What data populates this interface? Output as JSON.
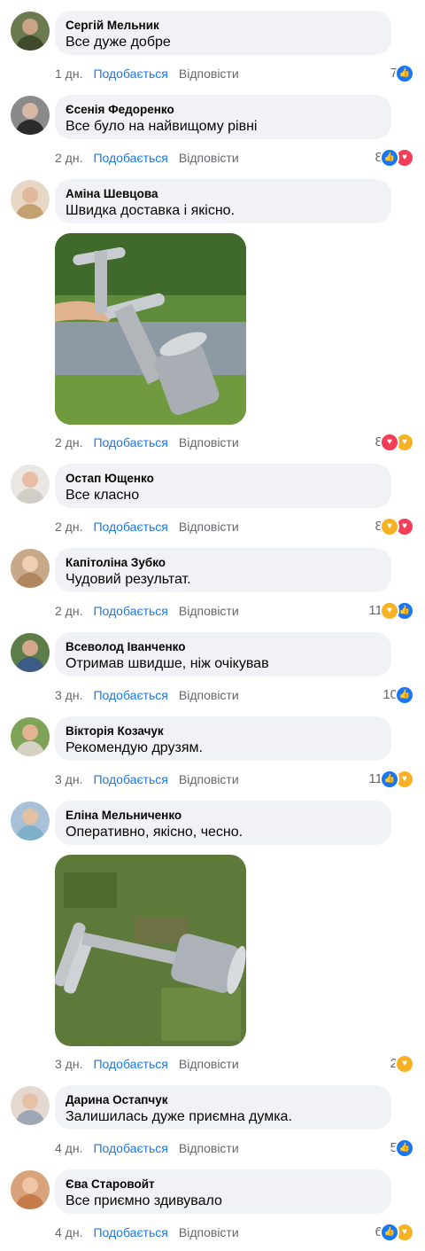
{
  "labels": {
    "like": "Подобається",
    "reply": "Відповісти"
  },
  "comments": [
    {
      "name": "Сергій Мельник",
      "text": "Все дуже добре",
      "time": "1 дн.",
      "count": "7",
      "reactions": [
        "like"
      ]
    },
    {
      "name": "Єсенія Федоренко",
      "text": "Все було на найвищому рівні",
      "time": "2 дн.",
      "count": "8",
      "reactions": [
        "like",
        "love"
      ]
    },
    {
      "name": "Аміна Шевцова",
      "text": "Швидка доставка і якісно.",
      "time": "2 дн.",
      "count": "8",
      "reactions": [
        "love",
        "care"
      ]
    },
    {
      "name": "Остап Ющенко",
      "text": "Все класно",
      "time": "2 дн.",
      "count": "8",
      "reactions": [
        "care",
        "love"
      ]
    },
    {
      "name": "Капітоліна Зубко",
      "text": "Чудовий результат.",
      "time": "2 дн.",
      "count": "11",
      "reactions": [
        "care",
        "like"
      ]
    },
    {
      "name": "Всеволод Іванченко",
      "text": "Отримав швидше, ніж очікував",
      "time": "3 дн.",
      "count": "10",
      "reactions": [
        "like"
      ]
    },
    {
      "name": "Вікторія Козачук",
      "text": "Рекомендую друзям.",
      "time": "3 дн.",
      "count": "11",
      "reactions": [
        "like",
        "care"
      ]
    },
    {
      "name": "Еліна Мельниченко",
      "text": "Оперативно, якісно, чесно.",
      "time": "3 дн.",
      "count": "2",
      "reactions": [
        "care"
      ]
    },
    {
      "name": "Дарина Остапчук",
      "text": "Залишилась дуже приємна думка.",
      "time": "4 дн.",
      "count": "5",
      "reactions": [
        "like"
      ]
    },
    {
      "name": "Єва Старовойт",
      "text": "Все приємно здивувало",
      "time": "4 дн.",
      "count": "6",
      "reactions": [
        "like",
        "care"
      ]
    }
  ],
  "colors": {
    "like": "#1877f2",
    "love": "#f33e58",
    "care": "#f7b125",
    "bubble": "#f0f2f5",
    "meta": "#65676b"
  }
}
